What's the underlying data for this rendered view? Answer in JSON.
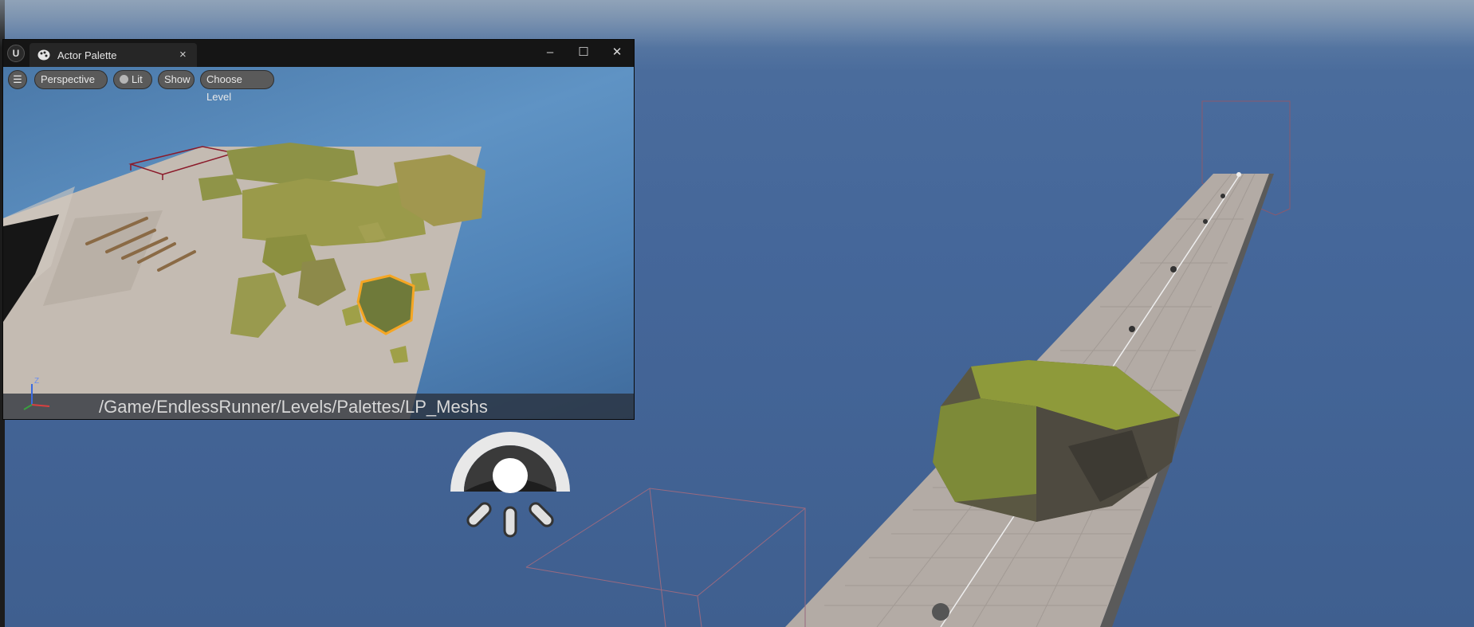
{
  "window": {
    "title": "Actor Palette",
    "logo_text": "U",
    "close_glyph": "×",
    "minimize_glyph": "–",
    "maximize_glyph": "☐",
    "window_close_glyph": "✕"
  },
  "toolbar": {
    "menu_glyph": "☰",
    "perspective_label": "Perspective",
    "lit_label": "Lit",
    "show_label": "Show",
    "choose_level_label": "Choose Level"
  },
  "viewport": {
    "path": "/Game/EndlessRunner/Levels/Palettes/LP_Meshs",
    "axis_z": "Z"
  },
  "icons": {
    "menu": "hamburger-menu-icon",
    "tab": "palette-icon",
    "light": "directional-light-icon"
  },
  "colors": {
    "selection": "#f5a623",
    "sky": "#4a6c9c",
    "floor": "#b8ada5"
  }
}
